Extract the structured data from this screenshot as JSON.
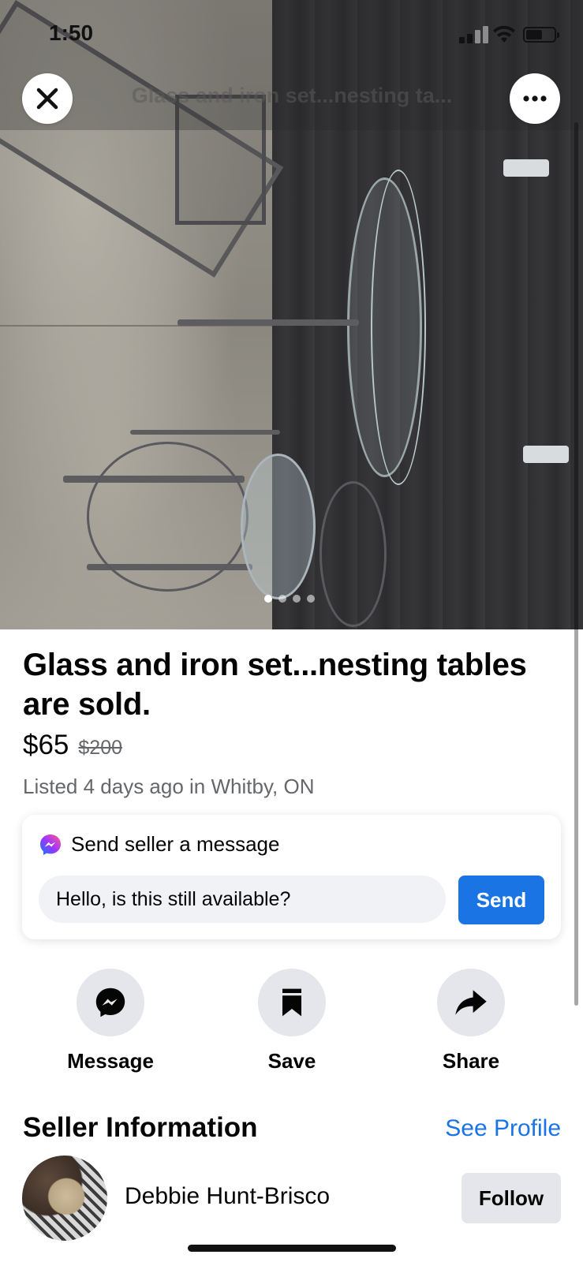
{
  "status_bar": {
    "time": "1:50"
  },
  "header": {
    "title": "Glass and iron set...nesting ta..."
  },
  "photo": {
    "dots_count": 4,
    "active_dot": 1
  },
  "listing": {
    "title": "Glass and iron set...nesting tables are sold.",
    "price": "$65",
    "original_price": "$200",
    "meta": "Listed 4 days ago in Whitby, ON"
  },
  "message_card": {
    "heading": "Send seller a message",
    "input_value": "Hello, is this still available?",
    "send_label": "Send"
  },
  "actions": [
    {
      "label": "Message",
      "icon": "messenger-icon"
    },
    {
      "label": "Save",
      "icon": "bookmark-icon"
    },
    {
      "label": "Share",
      "icon": "share-arrow-icon"
    }
  ],
  "seller": {
    "section_title": "Seller Information",
    "see_profile_label": "See Profile",
    "name": "Debbie Hunt-Brisco",
    "follow_label": "Follow"
  },
  "colors": {
    "accent": "#1b74e4",
    "secondary_text": "#65676b",
    "button_gray": "#e4e6eb"
  }
}
